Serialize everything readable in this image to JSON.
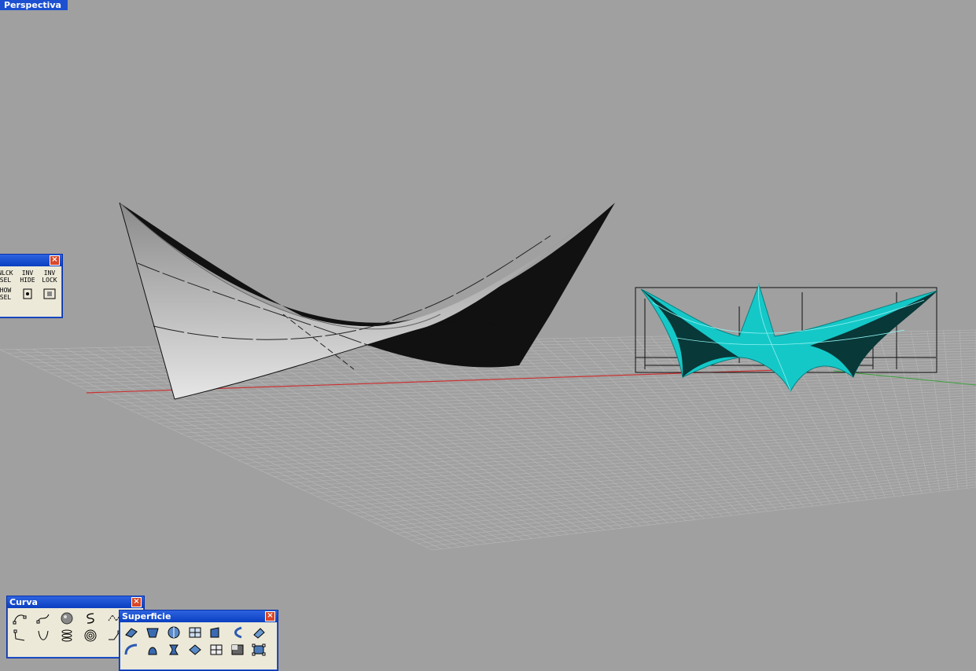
{
  "viewport": {
    "label": "Perspectiva"
  },
  "visibility_panel": {
    "close_label": "×",
    "buttons": [
      {
        "name": "unlock-sel-button",
        "label": "NLCK\nSEL"
      },
      {
        "name": "inv-hide-button",
        "label": "INV\nHIDE"
      },
      {
        "name": "inv-lock-button",
        "label": "INV\nLOCK"
      },
      {
        "name": "show-sel-button",
        "label": "HOW\nSEL"
      }
    ]
  },
  "curva_panel": {
    "title": "Curva",
    "close_label": "×",
    "tools": [
      "control-point-curve-icon",
      "interpolate-curve-icon",
      "sphere-icon",
      "freeform-s-curve-icon",
      "polyline-icon",
      "curve-on-surface-icon",
      "parabola-icon",
      "helix-icon",
      "spiral-icon",
      "polyline-through-points-icon"
    ]
  },
  "superficie_panel": {
    "title": "Superficie",
    "close_label": "×",
    "tools": [
      "surface-from-points-icon",
      "surface-from-edges-icon",
      "revolve-icon",
      "surface-grid-icon",
      "extrude-surface-icon",
      "loft-icon",
      "sweep-icon",
      "rail-revolve-icon",
      "patch-icon",
      "blend-surface-icon",
      "network-surface-icon",
      "plane-icon",
      "rectangular-plane-icon",
      "control-points-surface-icon"
    ]
  },
  "colors": {
    "background": "#a0a0a0",
    "accent": "#1c50d0",
    "cyan_surface": "#15c8c8"
  }
}
